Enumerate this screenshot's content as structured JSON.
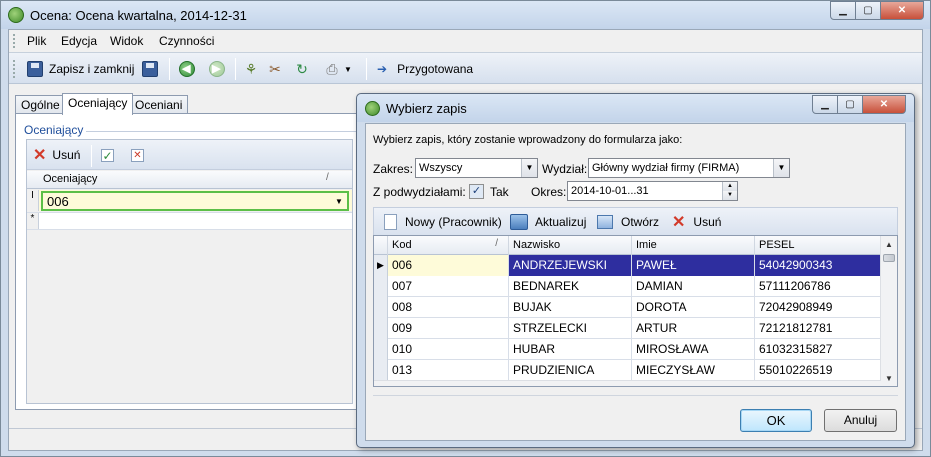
{
  "main_window": {
    "title": "Ocena: Ocena kwartalna, 2014-12-31",
    "controls": {
      "minimize": "▁",
      "maximize": "▢",
      "close": "✕"
    }
  },
  "menu": [
    "Plik",
    "Edycja",
    "Widok",
    "Czynności"
  ],
  "toolbar": {
    "save_close_label": "Zapisz i zamknij",
    "status_label": "Przygotowana",
    "icons": [
      "save-icon",
      "save-as-icon",
      "back-icon",
      "forward-icon",
      "tree-icon",
      "tools-icon",
      "refresh-icon",
      "print-icon",
      "dropdown-arrow-icon",
      "status-arrow-icon"
    ]
  },
  "tabs": [
    "Ogólne",
    "Oceniający",
    "Oceniani"
  ],
  "active_tab": "Oceniający",
  "oceniajacy_panel": {
    "group_title": "Oceniający",
    "delete_label": "Usuń",
    "grid_header": "Oceniający",
    "sort_marker": "/",
    "current_row_marker": "I",
    "new_row_marker": "*",
    "current_value": "006"
  },
  "dialog": {
    "title": "Wybierz zapis",
    "controls": {
      "minimize": "▁",
      "maximize": "▢",
      "close": "✕"
    },
    "prompt": "Wybierz zapis, który zostanie wprowadzony do formularza jako:",
    "filters": {
      "zakres_label": "Zakres:",
      "zakres_value": "Wszyscy",
      "wydzial_label": "Wydział:",
      "wydzial_value": "Główny wydział firmy (FIRMA)",
      "podwydzialy_label": "Z podwydziałami:",
      "podwydzialy_checked": true,
      "podwydzialy_text": "Tak",
      "okres_label": "Okres:",
      "okres_value": "2014-10-01...31"
    },
    "toolbar": {
      "new_label": "Nowy (Pracownik)",
      "refresh_label": "Aktualizuj",
      "open_label": "Otwórz",
      "delete_label": "Usuń"
    },
    "grid": {
      "columns": [
        "Kod",
        "Nazwisko",
        "Imie",
        "PESEL"
      ],
      "sort_marker": "/",
      "rows": [
        {
          "kod": "006",
          "nazwisko": "ANDRZEJEWSKI",
          "imie": "PAWEŁ",
          "pesel": "54042900343",
          "selected": true
        },
        {
          "kod": "007",
          "nazwisko": "BEDNAREK",
          "imie": "DAMIAN",
          "pesel": "57111206786",
          "selected": false
        },
        {
          "kod": "008",
          "nazwisko": "BUJAK",
          "imie": "DOROTA",
          "pesel": "72042908949",
          "selected": false
        },
        {
          "kod": "009",
          "nazwisko": "STRZELECKI",
          "imie": "ARTUR",
          "pesel": "72121812781",
          "selected": false
        },
        {
          "kod": "010",
          "nazwisko": "HUBAR",
          "imie": "MIROSŁAWA",
          "pesel": "61032315827",
          "selected": false
        },
        {
          "kod": "013",
          "nazwisko": "PRUDZIENICA",
          "imie": "MIECZYSŁAW",
          "pesel": "55010226519",
          "selected": false
        }
      ]
    },
    "ok_label": "OK",
    "cancel_label": "Anuluj"
  },
  "colors": {
    "selection": "#2e2e9f",
    "current_cell": "#fefbd9",
    "focus_border": "#5cbf47",
    "delete_red": "#d23a2a"
  }
}
